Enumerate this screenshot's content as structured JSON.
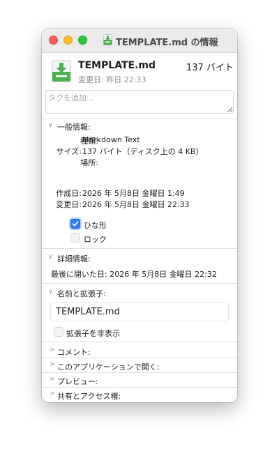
{
  "window": {
    "title": "TEMPLATE.md の情報"
  },
  "header": {
    "filename": "TEMPLATE.md",
    "size": "137 バイト",
    "modified": "変更日: 昨日 22:33"
  },
  "tags": {
    "placeholder": "タグを追加..."
  },
  "general": {
    "header": "一般情報:",
    "kind_label": "種類:",
    "kind_value": "Markdown Text",
    "size_label": "サイズ:",
    "size_value": "137 バイト（ディスク上の 4 KB）",
    "where_label": "場所:",
    "where_value": "",
    "created_label": "作成日:",
    "created_value": "2026 年 5月8日 金曜日 1:49",
    "modified_label": "変更日:",
    "modified_value": "2026 年 5月8日 金曜日 22:33",
    "stationery_label": "ひな形",
    "stationery_checked": true,
    "locked_label": "ロック",
    "locked_checked": false
  },
  "more_info": {
    "header": "詳細情報:",
    "last_opened": "最後に開いた日: 2026 年 5月8日 金曜日 22:32"
  },
  "name_ext": {
    "header": "名前と拡張子:",
    "value": "TEMPLATE.md",
    "hide_ext_label": "拡張子を非表示",
    "hide_ext_checked": false
  },
  "collapsed_sections": {
    "comments": "コメント:",
    "open_with": "このアプリケーションで開く:",
    "preview": "プレビュー:",
    "sharing": "共有とアクセス権:"
  },
  "colors": {
    "accent": "#2e7cf6",
    "icon_green": "#4caf50",
    "close": "#ff5f57",
    "minimize": "#febc2e",
    "zoom": "#28c840"
  },
  "icons": {
    "file": "markdown-download-file-icon",
    "expanded": "chevron-down-icon",
    "collapsed": "chevron-right-icon"
  }
}
